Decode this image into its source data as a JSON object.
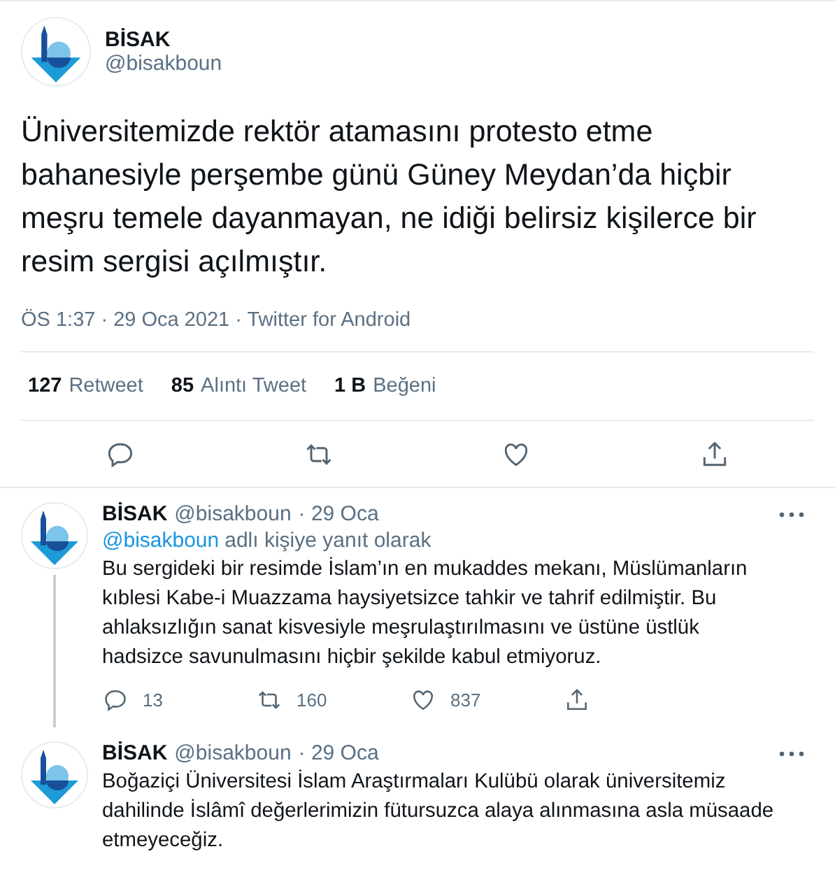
{
  "tweet": {
    "name": "BİSAK",
    "handle": "@bisakboun",
    "text": "Üniversitemizde rektör atamasını protesto etme bahanesiyle perşembe günü Güney Meydan’da hiçbir meşru temele dayanmayan, ne idiği belirsiz kişilerce bir resim sergisi açılmıştır.",
    "meta": "ÖS 1:37 · 29 Oca 2021 · Twitter for Android",
    "stats": [
      {
        "count": "127",
        "label": "Retweet"
      },
      {
        "count": "85",
        "label": "Alıntı Tweet"
      },
      {
        "count": "1 B",
        "label": "Beğeni"
      }
    ]
  },
  "replies": [
    {
      "name": "BİSAK",
      "handle": "@bisakboun",
      "time": "· 29 Oca",
      "thread_line": true,
      "reply_to": {
        "handle": "@bisakboun",
        "text": "adlı kişiye yanıt olarak"
      },
      "text": "Bu sergideki bir resimde İslam’ın en mukaddes mekanı, Müslümanların kıblesi Kabe-i Muazzama haysiyetsizce tahkir ve tahrif edilmiştir. Bu ahlaksızlığın sanat kisvesiyle meşrulaştırılmasını ve üstüne üstlük hadsizce savunulmasını hiçbir şekilde kabul etmiyoruz.",
      "counts": {
        "replies": "13",
        "retweets": "160",
        "likes": "837"
      }
    },
    {
      "name": "BİSAK",
      "handle": "@bisakboun",
      "time": "· 29 Oca",
      "thread_line": false,
      "text": "Boğaziçi Üniversitesi İslam Araştırmaları Kulübü olarak üniversitemiz dahilinde İslâmî değerlerimizin fütursuzca alaya alınmasına asla müsaade etmeyeceğiz."
    }
  ]
}
